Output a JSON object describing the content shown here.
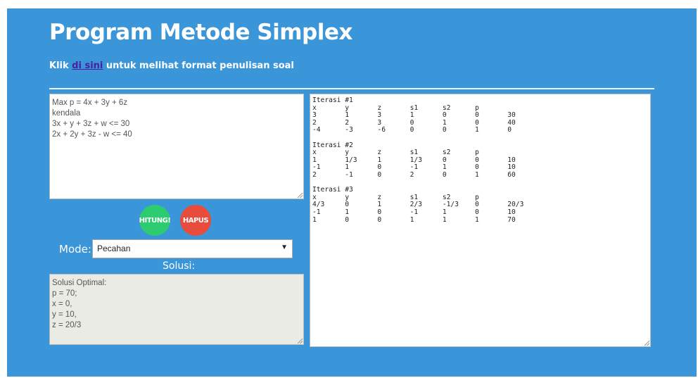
{
  "header": {
    "title": "Program Metode Simplex",
    "instruction_prefix": "Klik ",
    "instruction_link": "di sini",
    "instruction_suffix": " untuk melihat format penulisan soal"
  },
  "problem_input": {
    "value": "Max p = 4x + 3y + 6z\nkendala\n3x + y + 3z + w <= 30\n2x + 2y + 3z - w <= 40"
  },
  "buttons": {
    "hitung_label": "HITUNG!",
    "hapus_label": "HAPUS"
  },
  "mode": {
    "label": "Mode:",
    "selected": "Pecahan"
  },
  "solution": {
    "label": "Solusi:",
    "value": "Solusi Optimal:\np = 70;\nx = 0,\ny = 10,\nz = 20/3"
  },
  "iterations_output": {
    "value": "Iterasi #1\nx       y       z       s1      s2      p\n3       1       3       1       0       0       30\n2       2       3       0       1       0       40\n-4      -3      -6      0       0       1       0\n\nIterasi #2\nx       y       z       s1      s2      p\n1       1/3     1       1/3     0       0       10\n-1      1       0       -1      1       0       10\n2       -1      0       2       0       1       60\n\nIterasi #3\nx       y       z       s1      s2      p\n4/3     0       1       2/3     -1/3    0       20/3\n-1      1       0       -1      1       0       10\n1       0       0       1       1       1       70"
  },
  "colors": {
    "background": "#3b96d9",
    "hitung_button": "#2ecc71",
    "hapus_button": "#e74c3c",
    "link": "#4a1f9e"
  }
}
